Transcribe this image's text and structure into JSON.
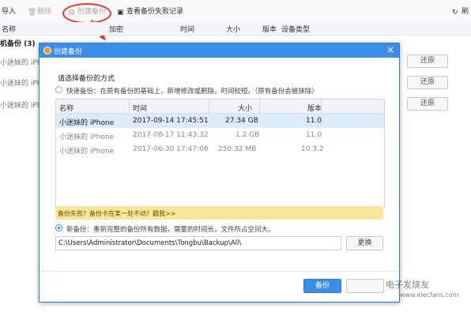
{
  "toolbar": {
    "import_label": "导入",
    "delete_label": "删除",
    "create_backup_label": "创建备份",
    "view_failed_label": "查看备份失败记录",
    "refresh_label": "刷"
  },
  "grid": {
    "columns": [
      "名称",
      "加密",
      "时间",
      "大小",
      "版本",
      "设备类型"
    ]
  },
  "group": {
    "label": "机备份 (3)"
  },
  "bg_rows": [
    {
      "name": "小迷妹的 iPh",
      "restore": "还原"
    },
    {
      "name": "小迷妹的 iPh",
      "restore": "还原"
    },
    {
      "name": "小迷妹的 iPh",
      "restore": "还原"
    }
  ],
  "dialog": {
    "title": "创建备份",
    "close": "×",
    "section_title": "请选择备份的方式",
    "quick_option": "快速备份：在原有备份的基础上，新增修改或删除，时间较短。（原有备份会被抹除）",
    "new_option": "新备份：重新完整的备份所有数据，需要的时间长，文件所占空间大。",
    "list_columns": [
      "名称",
      "时间",
      "大小",
      "版本"
    ],
    "backups": [
      {
        "name": "小迷妹的 iPhone",
        "time": "2017-09-14 17:45:51",
        "size": "27.34 GB",
        "version": "11.0"
      },
      {
        "name": "小迷妹的 iPhone",
        "time": "2017-08-17 11:43:32",
        "size": "1.2 GB",
        "version": "11.0"
      },
      {
        "name": "小迷妹的 iPhone",
        "time": "2017-06-30 17:47:06",
        "size": "250.32 MB",
        "version": "10.3.2"
      }
    ],
    "warning": "备份失败？备份卡在某一处不动？戳我>>",
    "path": "C:\\Users\\Administrator\\Documents\\Tongbu\\Backup\\All\\",
    "change_label": "更换",
    "backup_label": "备份"
  },
  "watermark": {
    "line1": "电子发烧友",
    "line2": "www.elecfans.com"
  },
  "colors": {
    "accent": "#3a8ee6",
    "warning_bg": "#f8e79a",
    "highlight": "#e33333",
    "selected_row": "#dcebfa"
  }
}
